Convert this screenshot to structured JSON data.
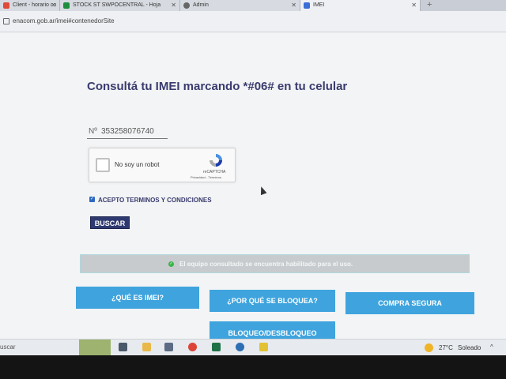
{
  "browser": {
    "tabs": [
      {
        "label": "Client - horario co",
        "icon": "client-tab-icon",
        "color": "#e04a3a"
      },
      {
        "label": "STOCK ST SWPOCENTRAL - Hoja",
        "icon": "sheets-tab-icon",
        "color": "#1e8e3e"
      },
      {
        "label": "Admin",
        "icon": "admin-tab-icon",
        "color": "#666666"
      },
      {
        "label": "IMEI",
        "icon": "imei-tab-icon",
        "color": "#3a6fd8"
      }
    ],
    "url": "enacom.gob.ar/imei#contenedorSite"
  },
  "page": {
    "title": "Consultá tu IMEI marcando *#06# en tu celular",
    "imei_prefix": "Nº",
    "imei_value": "353258076740",
    "recaptcha": {
      "label": "No soy un robot",
      "brand": "reCAPTCHA",
      "links": "Privacidad - Términos"
    },
    "terms_label": "ACEPTO TERMINOS Y CONDICIONES",
    "terms_checked_glyph": "✓",
    "search_button": "BUSCAR",
    "status": {
      "icon_glyph": "✓",
      "message": "El equipo consultado se encuentra habilitado para el uso."
    },
    "nav_buttons": {
      "que_es": "¿QUÉ ES IMEI?",
      "por_que": "¿POR QUÉ SE BLOQUEA?",
      "compra": "COMPRA SEGURA",
      "bloqueo": "BLOQUEO/DESBLOQUEO"
    }
  },
  "taskbar": {
    "search_placeholder": "uscar",
    "temperature": "27°C",
    "condition": "Soleado"
  },
  "colors": {
    "title": "#3a3b6e",
    "button_dark": "#2e3970",
    "nav_button": "#3fa4de",
    "status_bg": "#c7cbcd",
    "status_ok": "#3bb54a"
  }
}
